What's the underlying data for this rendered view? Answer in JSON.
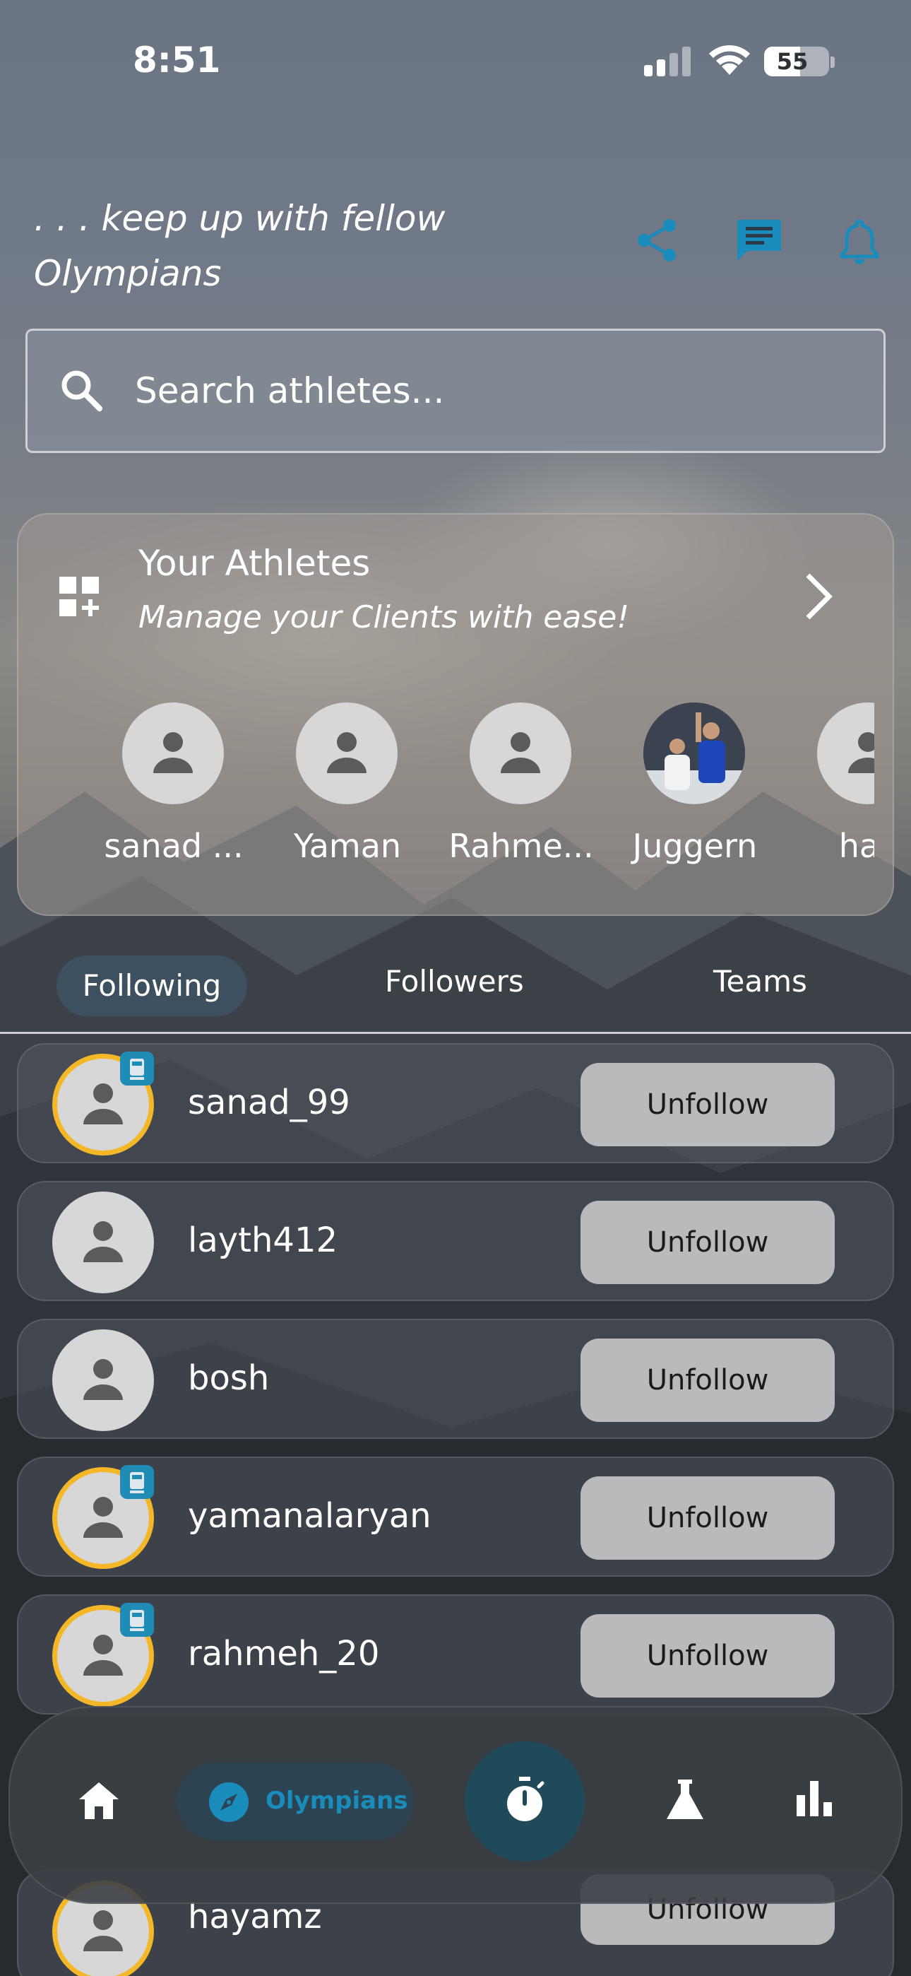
{
  "status_bar": {
    "time": "8:51",
    "battery": "55",
    "battery_level": 0.55
  },
  "header": {
    "tagline": ". . . keep up with fellow Olympians",
    "icons": [
      "share-icon",
      "chat-icon",
      "bell-icon"
    ],
    "accent": "#1a8cbc"
  },
  "search": {
    "placeholder": "Search athletes..."
  },
  "athletes_card": {
    "title": "Your Athletes",
    "subtitle": "Manage your Clients with ease!",
    "athletes": [
      {
        "name": "sanad ..."
      },
      {
        "name": "Yaman"
      },
      {
        "name": "Rahme..."
      },
      {
        "name": "Juggern"
      },
      {
        "name": "hay"
      }
    ]
  },
  "tabs": {
    "following": "Following",
    "followers": "Followers",
    "teams": "Teams",
    "selected": "Following"
  },
  "list": [
    {
      "username": "sanad_99",
      "action": "Unfollow",
      "ring": true
    },
    {
      "username": "layth412",
      "action": "Unfollow",
      "ring": false
    },
    {
      "username": "bosh",
      "action": "Unfollow",
      "ring": false
    },
    {
      "username": "yamanalaryan",
      "action": "Unfollow",
      "ring": true
    },
    {
      "username": "rahmeh_20",
      "action": "Unfollow",
      "ring": true
    },
    {
      "username": "hayamz",
      "action": "Unfollow",
      "ring": true
    }
  ],
  "bottom_nav": {
    "olympians_label": "Olympians",
    "items": [
      "home-icon",
      "compass-icon",
      "stopwatch-icon",
      "flask-icon",
      "bar-chart-icon"
    ]
  }
}
